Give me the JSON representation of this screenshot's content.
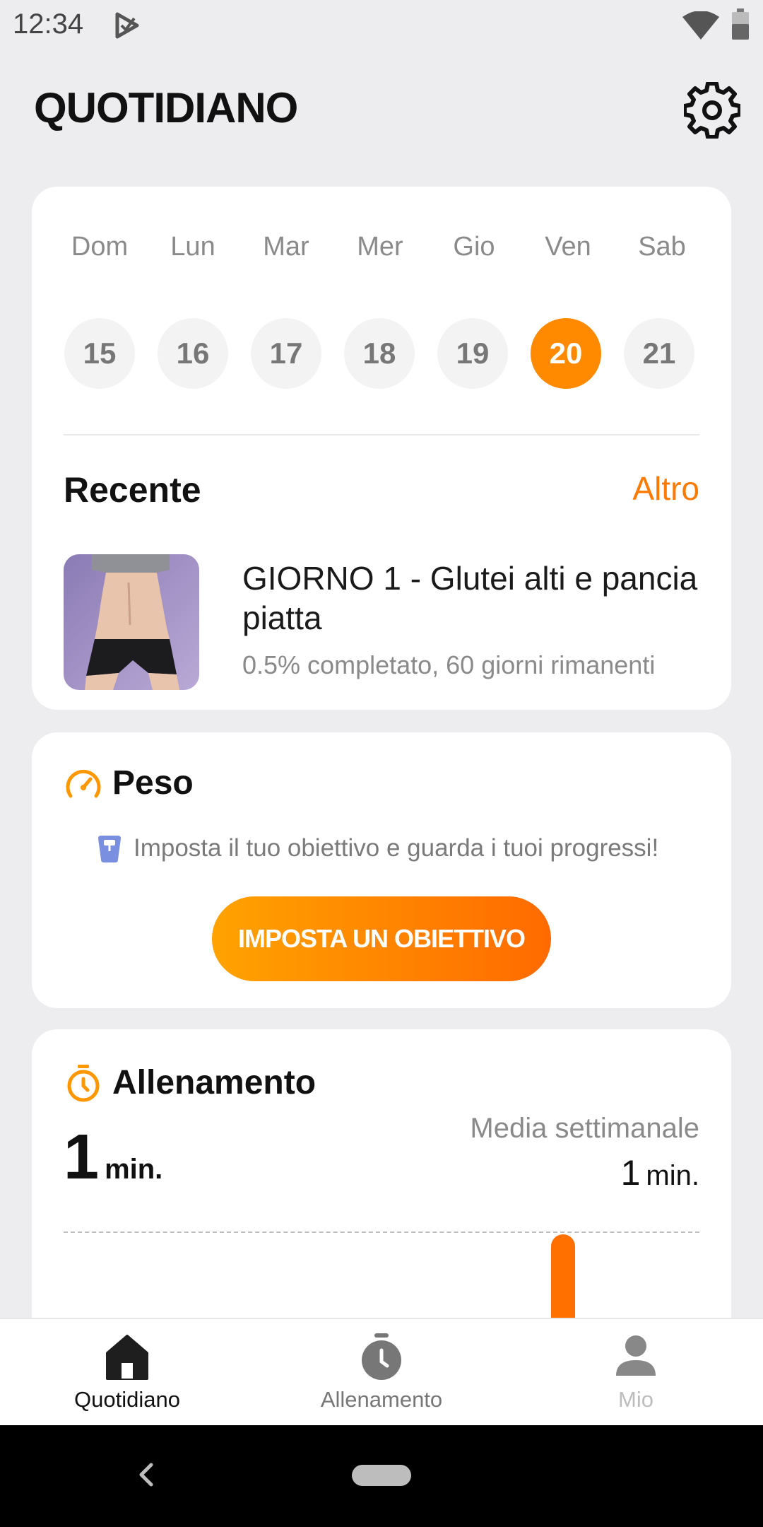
{
  "status_bar": {
    "time": "12:34"
  },
  "header": {
    "title": "QUOTIDIANO"
  },
  "week": {
    "day_names": [
      "Dom",
      "Lun",
      "Mar",
      "Mer",
      "Gio",
      "Ven",
      "Sab"
    ],
    "day_numbers": [
      "15",
      "16",
      "17",
      "18",
      "19",
      "20",
      "21"
    ],
    "selected_day": "20"
  },
  "recent": {
    "title": "Recente",
    "more_label": "Altro",
    "plan_title": "GIORNO 1 - Glutei alti e pancia piatta",
    "plan_subtitle": "0.5% completato, 60 giorni rimanenti"
  },
  "weight": {
    "title": "Peso",
    "hint": "Imposta il tuo obiettivo e guarda i tuoi progressi!",
    "button_label": "IMPOSTA UN OBIETTIVO"
  },
  "workout": {
    "title": "Allenamento",
    "value": "1",
    "unit": "min.",
    "weekly_label": "Media settimanale",
    "weekly_value": "1",
    "weekly_unit": "min."
  },
  "bottom_nav": {
    "items": [
      {
        "label": "Quotidiano",
        "icon": "home-icon",
        "active": true
      },
      {
        "label": "Allenamento",
        "icon": "stopwatch-icon",
        "active": false
      },
      {
        "label": "Mio",
        "icon": "person-icon",
        "active": false
      }
    ]
  },
  "colors": {
    "accent": "#ff7a00",
    "background": "#ededf0",
    "card": "#ffffff"
  }
}
